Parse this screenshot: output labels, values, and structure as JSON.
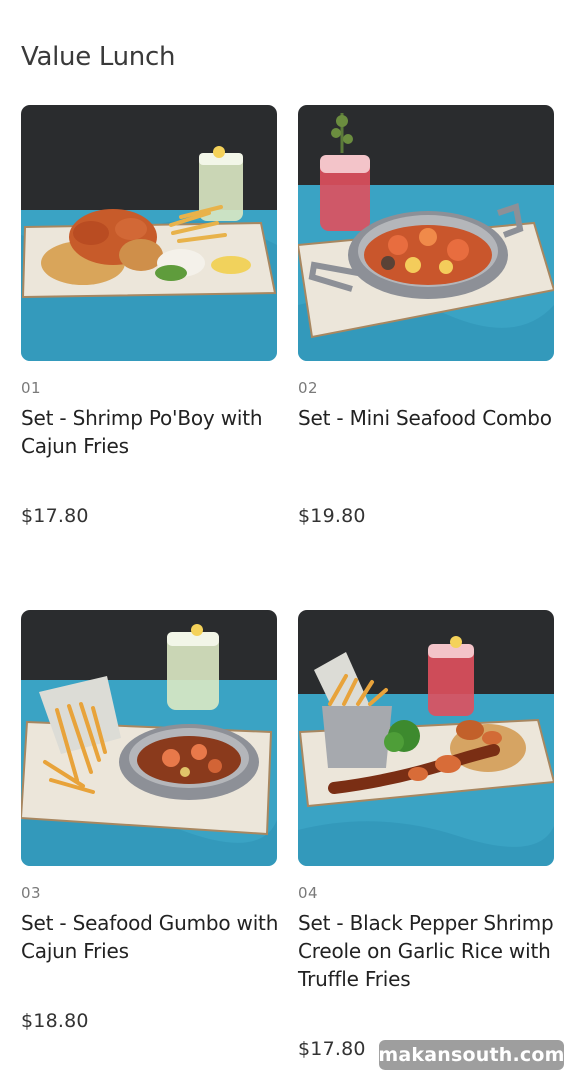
{
  "section": {
    "title": "Value Lunch"
  },
  "items": [
    {
      "number": "01",
      "name": "Set - Shrimp Po'Boy with Cajun Fries",
      "price": "$17.80"
    },
    {
      "number": "02",
      "name": "Set - Mini Seafood Combo",
      "price": "$19.80"
    },
    {
      "number": "03",
      "name": "Set - Seafood Gumbo with Cajun Fries",
      "price": "$18.80"
    },
    {
      "number": "04",
      "name": "Set - Black Pepper Shrimp Creole on Garlic Rice with Truffle Fries",
      "price": "$17.80"
    }
  ],
  "watermark": "makansouth.com",
  "colors": {
    "wall": "#2a2c2e",
    "table": "#3aa3c4",
    "plate": "#ece6da"
  }
}
